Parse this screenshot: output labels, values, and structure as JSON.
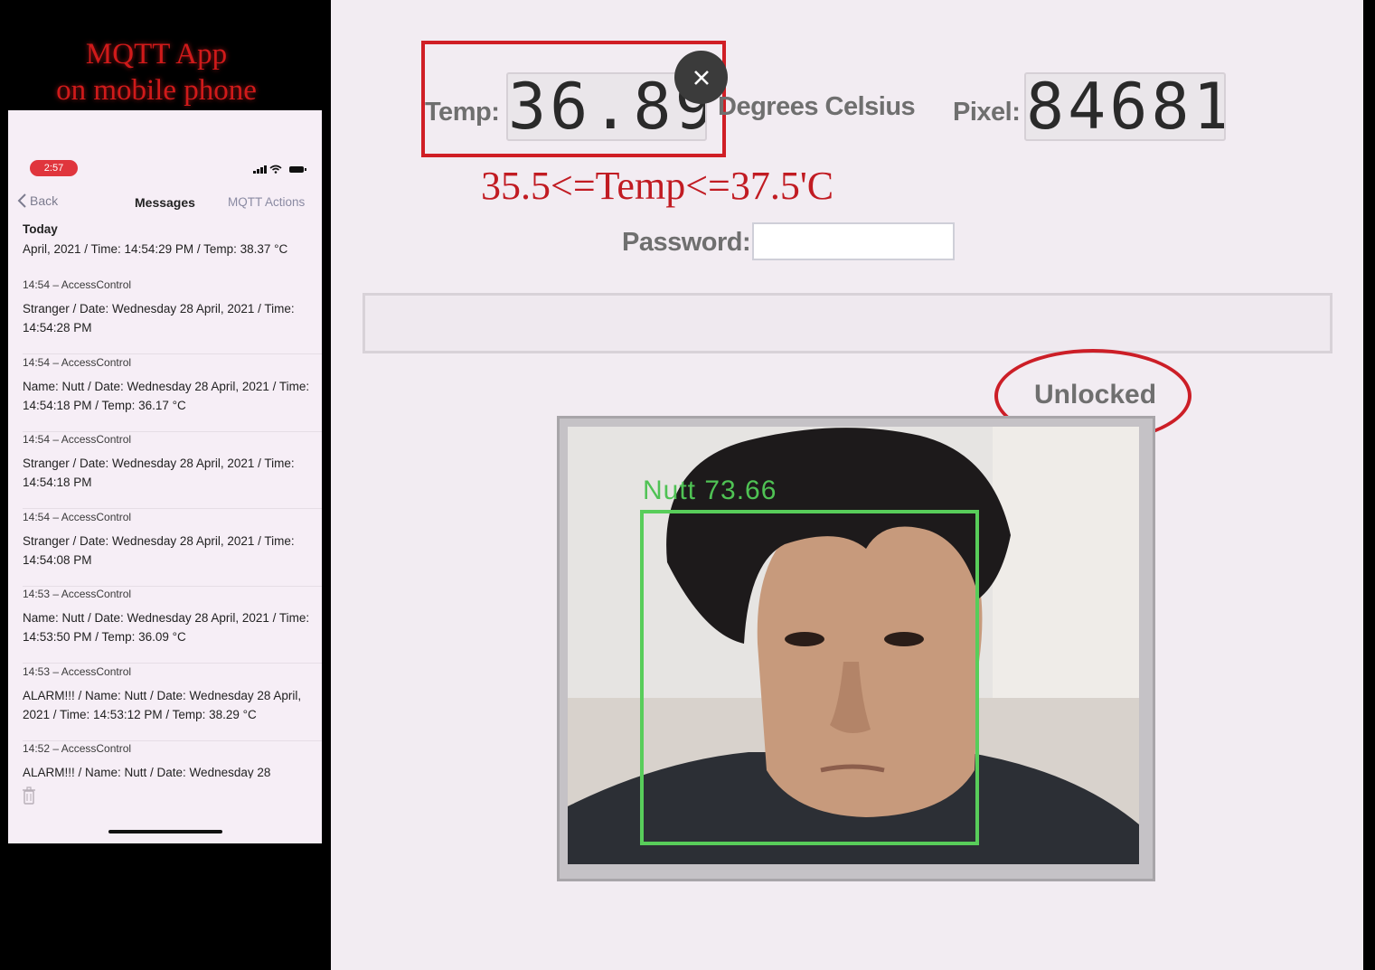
{
  "caption": {
    "line1": "MQTT App",
    "line2": "on mobile phone"
  },
  "phone": {
    "status_time": "2:57",
    "nav": {
      "back_label": "Back",
      "title": "Messages",
      "actions_label": "MQTT Actions"
    },
    "today_header": "Today",
    "today_line": "April, 2021 / Time: 14:54:29 PM / Temp: 38.37 °C",
    "messages": [
      {
        "head": "14:54 – AccessControl",
        "body": "Stranger / Date: Wednesday 28 April, 2021 / Time: 14:54:28 PM"
      },
      {
        "head": "14:54 – AccessControl",
        "body": "Name: Nutt / Date: Wednesday 28 April, 2021 / Time: 14:54:18 PM / Temp: 36.17 °C"
      },
      {
        "head": "14:54 – AccessControl",
        "body": "Stranger / Date: Wednesday 28 April, 2021 / Time: 14:54:18 PM"
      },
      {
        "head": "14:54 – AccessControl",
        "body": "Stranger / Date: Wednesday 28 April, 2021 / Time: 14:54:08 PM"
      },
      {
        "head": "14:53 – AccessControl",
        "body": "Name: Nutt / Date: Wednesday 28 April, 2021 / Time: 14:53:50 PM / Temp: 36.09 °C"
      },
      {
        "head": "14:53 – AccessControl",
        "body": "ALARM!!! / Name: Nutt / Date: Wednesday 28 April, 2021 / Time: 14:53:12 PM / Temp: 38.29 °C"
      },
      {
        "head": "14:52 – AccessControl",
        "body": "ALARM!!! / Name: Nutt / Date: Wednesday 28"
      }
    ]
  },
  "app": {
    "temp_label": "Temp:",
    "temp_value": "36.89",
    "unit_label": "Degrees Celsius",
    "pixel_label": "Pixel:",
    "pixel_value": "84681",
    "range_note": "35.5<=Temp<=37.5'C",
    "password_label": "Password:",
    "password_value": "",
    "message_value": "",
    "lock_status": "Unlocked",
    "face_label": "Nutt 73.66"
  },
  "colors": {
    "accent_red": "#d01e25",
    "face_box_green": "#58cd5a",
    "status_badge": "#e0353d"
  }
}
